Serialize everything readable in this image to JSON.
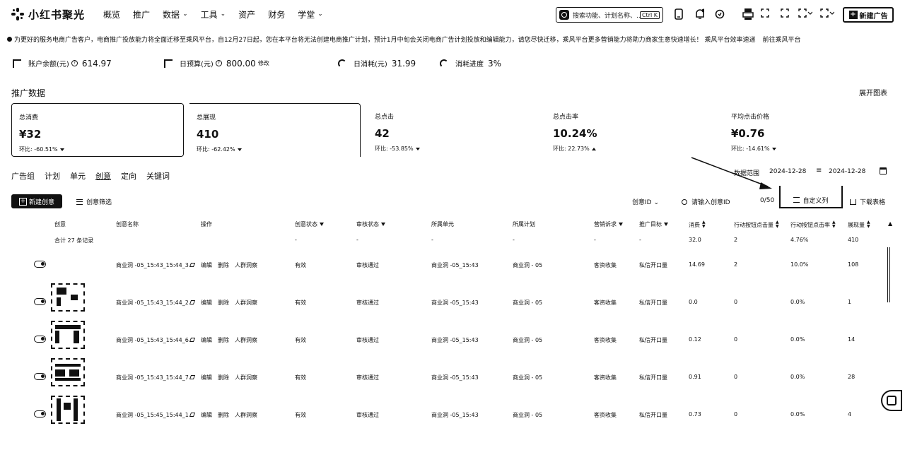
{
  "brand": {
    "name": "小红书聚光"
  },
  "nav": [
    {
      "label": "概览",
      "has_menu": false
    },
    {
      "label": "推广",
      "has_menu": false
    },
    {
      "label": "数据",
      "has_menu": true
    },
    {
      "label": "工具",
      "has_menu": true
    },
    {
      "label": "资产",
      "has_menu": false
    },
    {
      "label": "财务",
      "has_menu": false
    },
    {
      "label": "学堂",
      "has_menu": true
    }
  ],
  "search": {
    "placeholder": "搜索功能、计划名称、...",
    "shortcut": "Ctrl K"
  },
  "header": {
    "new_ad_label": "新建广告"
  },
  "notice": {
    "text": "为更好的服务电商广告客户，电商推广投放能力将全面迁移至乘风平台，自12月27日起，您在本平台将无法创建电商推广计划，预计1月中旬会关闭电商广告计划投放和编辑能力，请您尽快迁移，乘风平台更多营销能力将助力商家生意快速增长！ 乘风平台效率速递",
    "link": "前往乘风平台"
  },
  "account": {
    "balance_label": "账户余额(元)",
    "balance_value": "614.97",
    "budget_label": "日预算(元)",
    "budget_value": "800.00",
    "budget_edit": "修改",
    "spend_label": "日消耗(元)",
    "spend_value": "31.99",
    "progress_label": "消耗进度",
    "progress_value": "3%"
  },
  "section": {
    "title": "推广数据",
    "collapse": "展开图表"
  },
  "metrics": [
    {
      "label": "总消费",
      "value": "¥32",
      "trend": "环比: -60.51%",
      "dir": "down"
    },
    {
      "label": "总展现",
      "value": "410",
      "trend": "环比: -62.42%",
      "dir": "down"
    },
    {
      "label": "总点击",
      "value": "42",
      "trend": "环比: -53.85%",
      "dir": "down"
    },
    {
      "label": "总点击率",
      "value": "10.24%",
      "trend": "环比: 22.73%",
      "dir": "up"
    },
    {
      "label": "平均点击价格",
      "value": "¥0.76",
      "trend": "环比: -14.61%",
      "dir": "down"
    }
  ],
  "tabs": [
    "广告组",
    "计划",
    "单元",
    "创意",
    "定向",
    "关键词"
  ],
  "date_range": {
    "label": "数据范围",
    "start": "2024-12-28",
    "end": "2024-12-28"
  },
  "toolbar": {
    "new_creative": "新建创意",
    "filter": "创意筛选",
    "id_select": "创意ID",
    "id_placeholder": "请输入创意ID",
    "id_count": "0/50",
    "custom_columns": "自定义列",
    "download": "下载表格"
  },
  "table": {
    "headers": [
      "创意",
      "创意名称",
      "操作",
      "创意状态",
      "审核状态",
      "所属单元",
      "所属计划",
      "营销诉求",
      "推广目标",
      "消费",
      "行动按钮点击量",
      "行动按钮点击率",
      "展现量"
    ],
    "total": {
      "label": "合计 27 条记录",
      "status": "-",
      "audit": "-",
      "unit": "-",
      "plan": "-",
      "appeal": "-",
      "goal": "-",
      "spend": "32.0",
      "clicks": "2",
      "ctr": "4.76%",
      "impressions": "410"
    },
    "rows": [
      {
        "name": "商业洞 -05_15:43_15:44_3",
        "ops": [
          "编辑",
          "删除",
          "人群洞察"
        ],
        "status": "有效",
        "audit": "审核通过",
        "unit": "商业洞 -05_15:43",
        "plan": "商业洞 - 05",
        "appeal": "客资收集",
        "goal": "私信开口量",
        "spend": "14.69",
        "clicks": "2",
        "ctr": "10.0%",
        "impressions": "108"
      },
      {
        "name": "商业洞 -05_15:43_15:44_2",
        "ops": [
          "编辑",
          "删除",
          "人群洞察"
        ],
        "status": "有效",
        "audit": "审核通过",
        "unit": "商业洞 -05_15:43",
        "plan": "商业洞 - 05",
        "appeal": "客资收集",
        "goal": "私信开口量",
        "spend": "0.0",
        "clicks": "0",
        "ctr": "0.0%",
        "impressions": "1"
      },
      {
        "name": "商业洞 -05_15:43_15:44_6",
        "ops": [
          "编辑",
          "删除",
          "人群洞察"
        ],
        "status": "有效",
        "audit": "审核通过",
        "unit": "商业洞 -05_15:43",
        "plan": "商业洞 - 05",
        "appeal": "客资收集",
        "goal": "私信开口量",
        "spend": "0.12",
        "clicks": "0",
        "ctr": "0.0%",
        "impressions": "14"
      },
      {
        "name": "商业洞 -05_15:43_15:44_7",
        "ops": [
          "编辑",
          "删除",
          "人群洞察"
        ],
        "status": "有效",
        "audit": "审核通过",
        "unit": "商业洞 -05_15:43",
        "plan": "商业洞 - 05",
        "appeal": "客资收集",
        "goal": "私信开口量",
        "spend": "0.91",
        "clicks": "0",
        "ctr": "0.0%",
        "impressions": "28"
      },
      {
        "name": "商业洞 -05_15:45_15:44_1",
        "ops": [
          "编辑",
          "删除",
          "人群洞察"
        ],
        "status": "有效",
        "audit": "审核通过",
        "unit": "商业洞 -05_15:43",
        "plan": "商业洞 - 05",
        "appeal": "客资收集",
        "goal": "私信开口量",
        "spend": "0.73",
        "clicks": "0",
        "ctr": "0.0%",
        "impressions": "4"
      }
    ]
  },
  "colors": {
    "ink": "#111111",
    "background": "#ffffff"
  }
}
